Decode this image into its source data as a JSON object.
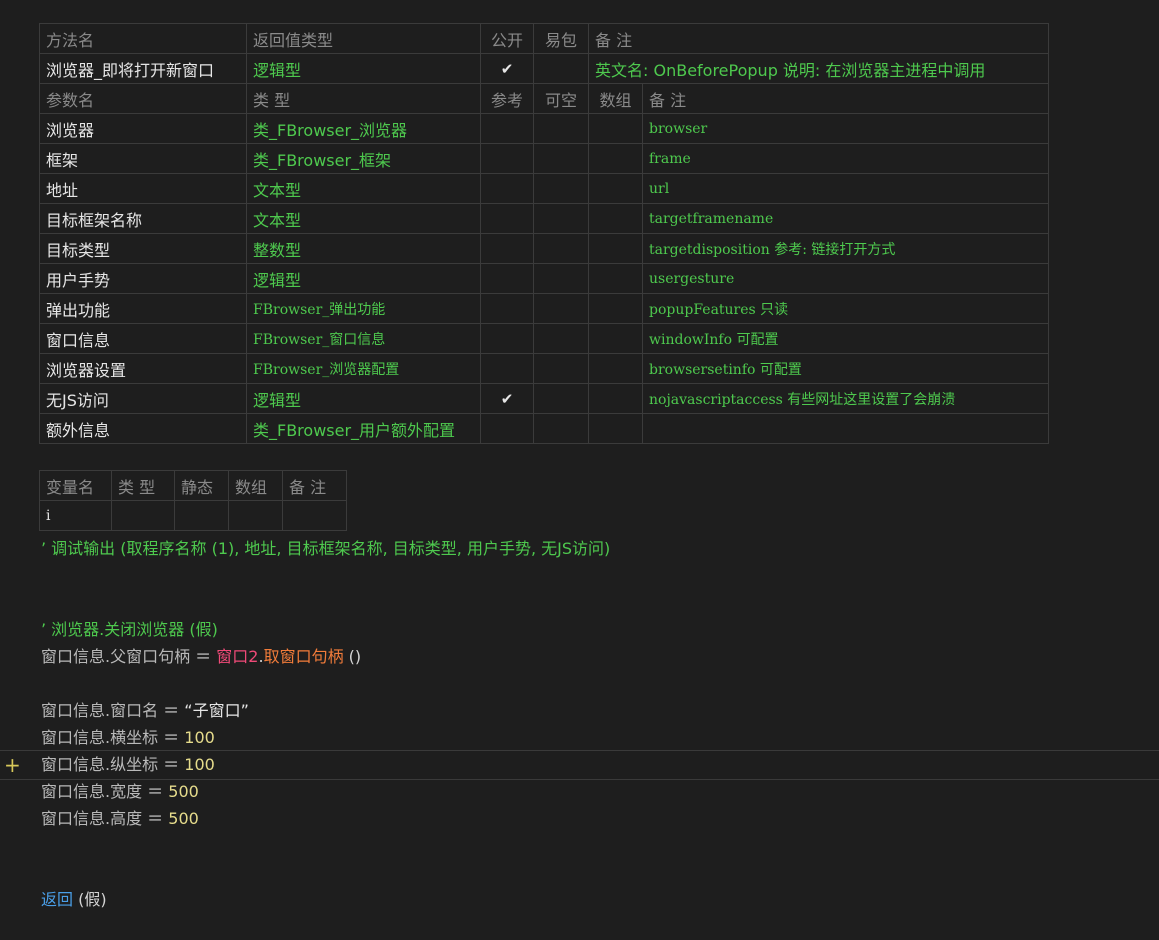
{
  "method_table": {
    "header": [
      "方法名",
      "返回值类型",
      "公开",
      "易包",
      "备 注"
    ],
    "method": {
      "name": "浏览器_即将打开新窗口",
      "return_type": "逻辑型",
      "public": "✔",
      "easy_pkg": "",
      "remark": "英文名: OnBeforePopup 说明: 在浏览器主进程中调用"
    },
    "param_header": [
      "参数名",
      "类 型",
      "参考",
      "可空",
      "数组",
      "备 注"
    ],
    "params": [
      {
        "name": "浏览器",
        "type": "类_FBrowser_浏览器",
        "ref": "",
        "nullable": "",
        "array": "",
        "remark": "browser"
      },
      {
        "name": "框架",
        "type": "类_FBrowser_框架",
        "ref": "",
        "nullable": "",
        "array": "",
        "remark": "frame"
      },
      {
        "name": "地址",
        "type": "文本型",
        "ref": "",
        "nullable": "",
        "array": "",
        "remark": "url"
      },
      {
        "name": "目标框架名称",
        "type": "文本型",
        "ref": "",
        "nullable": "",
        "array": "",
        "remark": "targetframename"
      },
      {
        "name": "目标类型",
        "type": "整数型",
        "ref": "",
        "nullable": "",
        "array": "",
        "remark": "targetdisposition 参考: 链接打开方式"
      },
      {
        "name": "用户手势",
        "type": "逻辑型",
        "ref": "",
        "nullable": "",
        "array": "",
        "remark": "usergesture"
      },
      {
        "name": "弹出功能",
        "type": "FBrowser_弹出功能",
        "ref": "",
        "nullable": "",
        "array": "",
        "remark": "popupFeatures 只读"
      },
      {
        "name": "窗口信息",
        "type": "FBrowser_窗口信息",
        "ref": "",
        "nullable": "",
        "array": "",
        "remark": "windowInfo 可配置"
      },
      {
        "name": "浏览器设置",
        "type": "FBrowser_浏览器配置",
        "ref": "",
        "nullable": "",
        "array": "",
        "remark": "browsersetinfo 可配置"
      },
      {
        "name": "无JS访问",
        "type": "逻辑型",
        "ref": "✔",
        "nullable": "",
        "array": "",
        "remark": "nojavascriptaccess 有些网址这里设置了会崩溃"
      },
      {
        "name": "额外信息",
        "type": "类_FBrowser_用户额外配置",
        "ref": "",
        "nullable": "",
        "array": "",
        "remark": ""
      }
    ]
  },
  "var_table": {
    "header": [
      "变量名",
      "类 型",
      "静态",
      "数组",
      "备 注"
    ],
    "rows": [
      {
        "name": "i",
        "type": "",
        "static": "",
        "array": "",
        "remark": ""
      }
    ]
  },
  "code": {
    "line1": "’ 调试输出 (取程序名称 (1), 地址, 目标框架名称, 目标类型, 用户手势, 无JS访问)",
    "line2": "’ 浏览器.关闭浏览器 (假)",
    "line3": {
      "lhs": "窗口信息.父窗口句柄",
      "eq": " ＝ ",
      "obj": "窗口2",
      "dot": ".",
      "method": "取窗口句柄",
      "args": " ()"
    },
    "line4": {
      "lhs": "窗口信息.窗口名",
      "eq": " ＝ ",
      "value": "“子窗口”"
    },
    "line5": {
      "lhs": "窗口信息.横坐标",
      "eq": " ＝ ",
      "value": "100"
    },
    "line6": {
      "lhs": "窗口信息.纵坐标",
      "eq": " ＝ ",
      "value": "100"
    },
    "line7": {
      "lhs": "窗口信息.宽度",
      "eq": " ＝ ",
      "value": "500"
    },
    "line8": {
      "lhs": "窗口信息.高度",
      "eq": " ＝ ",
      "value": "500"
    },
    "line9": {
      "kw": "返回",
      "args": " (假)"
    },
    "add_marker": "+"
  },
  "colors": {
    "background": "#1e1e1e",
    "comment_green": "#4ec94e",
    "number_yellow": "#e6dc8c",
    "keyword_blue": "#4a9fe8",
    "object_red": "#f04a78",
    "method_orange": "#f27c3a"
  }
}
